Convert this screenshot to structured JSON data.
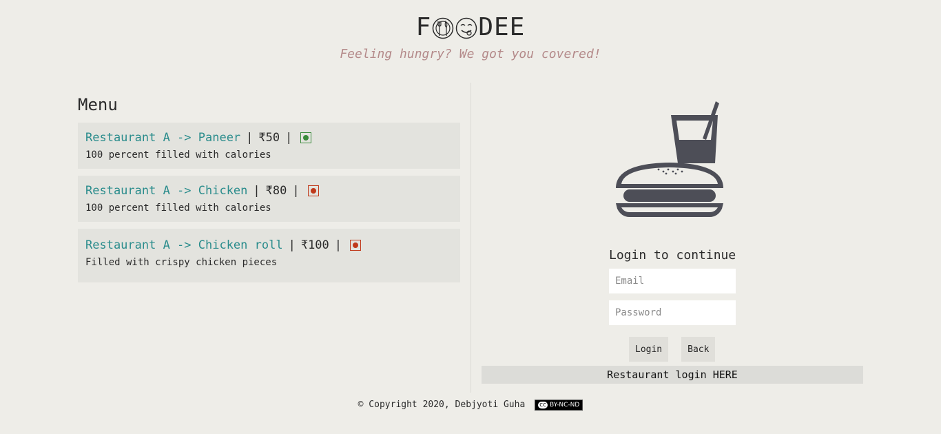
{
  "brand": {
    "prefix": "F",
    "suffix": "DEE",
    "tagline": "Feeling hungry? We got you covered!"
  },
  "menu": {
    "title": "Menu",
    "separator": "|",
    "items": [
      {
        "name": "Restaurant A -> Paneer",
        "price": "₹50",
        "type": "veg",
        "description": "100 percent filled with calories"
      },
      {
        "name": "Restaurant A -> Chicken",
        "price": "₹80",
        "type": "non-veg",
        "description": "100 percent filled with calories"
      },
      {
        "name": "Restaurant A -> Chicken roll",
        "price": "₹100",
        "type": "non-veg",
        "description": "Filled with crispy chicken pieces"
      }
    ]
  },
  "login": {
    "title": "Login to continue",
    "email_placeholder": "Email",
    "password_placeholder": "Password",
    "login_label": "Login",
    "back_label": "Back",
    "restaurant_link": "Restaurant login HERE"
  },
  "footer": {
    "copyright": "© Copyright 2020, Debjyoti Guha",
    "license_badge": "BY-NC-ND",
    "license_cc": "cc"
  },
  "colors": {
    "background": "#eeede8",
    "item_name": "#2a8c8c",
    "tagline": "#b48a8a",
    "veg": "#3a8a3a",
    "non_veg": "#c0391b",
    "illustration": "#4d4e57"
  }
}
